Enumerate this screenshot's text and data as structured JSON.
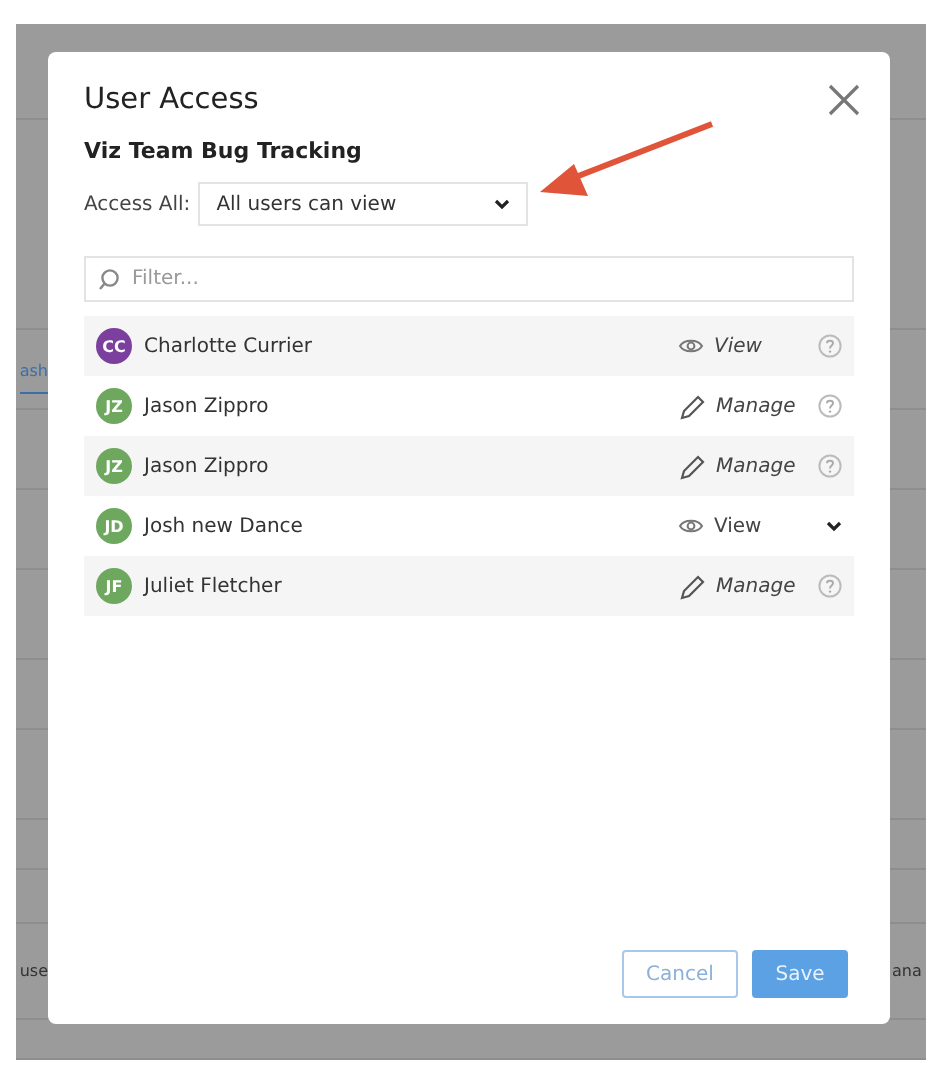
{
  "background": {
    "fragments": [
      {
        "text": "ash",
        "kind": "link"
      },
      {
        "text": "use",
        "kind": "left"
      },
      {
        "text": "ana",
        "kind": "right"
      }
    ]
  },
  "dialog": {
    "title": "User Access",
    "subtitle": "Viz Team Bug Tracking",
    "access_all": {
      "label": "Access All:",
      "value": "All users can view"
    },
    "filter": {
      "placeholder": "Filter..."
    },
    "users": [
      {
        "initials": "CC",
        "name": "Charlotte Currier",
        "color": "#7b3f9e",
        "kind": "view",
        "role": "View",
        "editable": false
      },
      {
        "initials": "JZ",
        "name": "Jason Zippro",
        "color": "#6ea75e",
        "kind": "manage",
        "role": "Manage",
        "editable": false
      },
      {
        "initials": "JZ",
        "name": "Jason Zippro",
        "color": "#6ea75e",
        "kind": "manage",
        "role": "Manage",
        "editable": false
      },
      {
        "initials": "JD",
        "name": "Josh new Dance",
        "color": "#6ea75e",
        "kind": "view",
        "role": "View",
        "editable": true
      },
      {
        "initials": "JF",
        "name": "Juliet Fletcher",
        "color": "#6ea75e",
        "kind": "manage",
        "role": "Manage",
        "editable": false
      }
    ],
    "buttons": [
      {
        "label": "Cancel",
        "kind": "secondary"
      },
      {
        "label": "Save",
        "kind": "primary"
      }
    ]
  },
  "annotation": {
    "kind": "arrow"
  }
}
